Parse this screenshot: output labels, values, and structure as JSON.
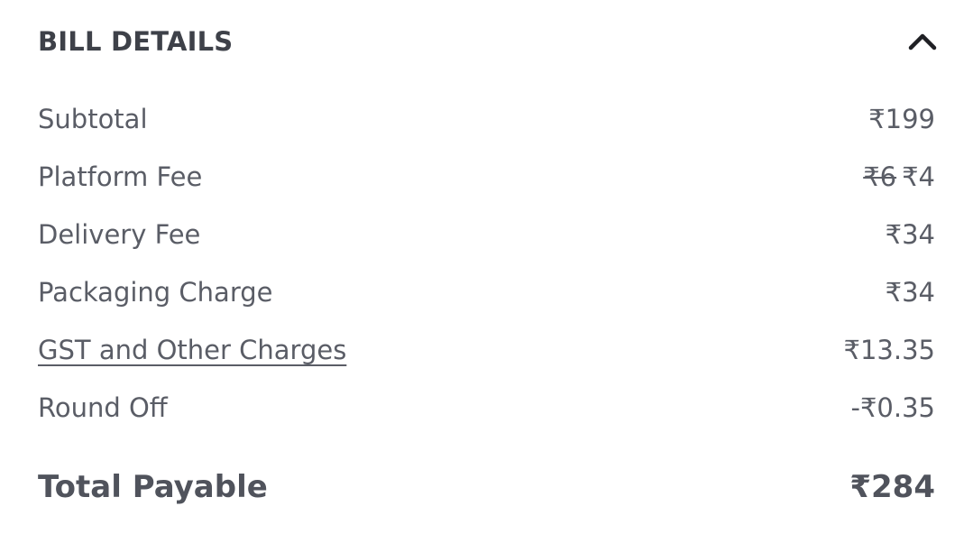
{
  "bill": {
    "title": "BILL DETAILS",
    "collapse_icon": "chevron-up-icon",
    "rows": [
      {
        "label": "Subtotal",
        "value": "₹199"
      },
      {
        "label": "Platform Fee",
        "original_value": "₹6",
        "value": "₹4"
      },
      {
        "label": "Delivery Fee",
        "value": "₹34"
      },
      {
        "label": "Packaging Charge",
        "value": "₹34"
      },
      {
        "label": "GST and Other Charges",
        "value": "₹13.35"
      },
      {
        "label": "Round Off",
        "value": "-₹0.35"
      }
    ],
    "total": {
      "label": "Total Payable",
      "value": "₹284"
    }
  },
  "colors": {
    "title": "#3e4149",
    "text": "#5a5d66",
    "total": "#50535c",
    "background": "#ffffff"
  }
}
